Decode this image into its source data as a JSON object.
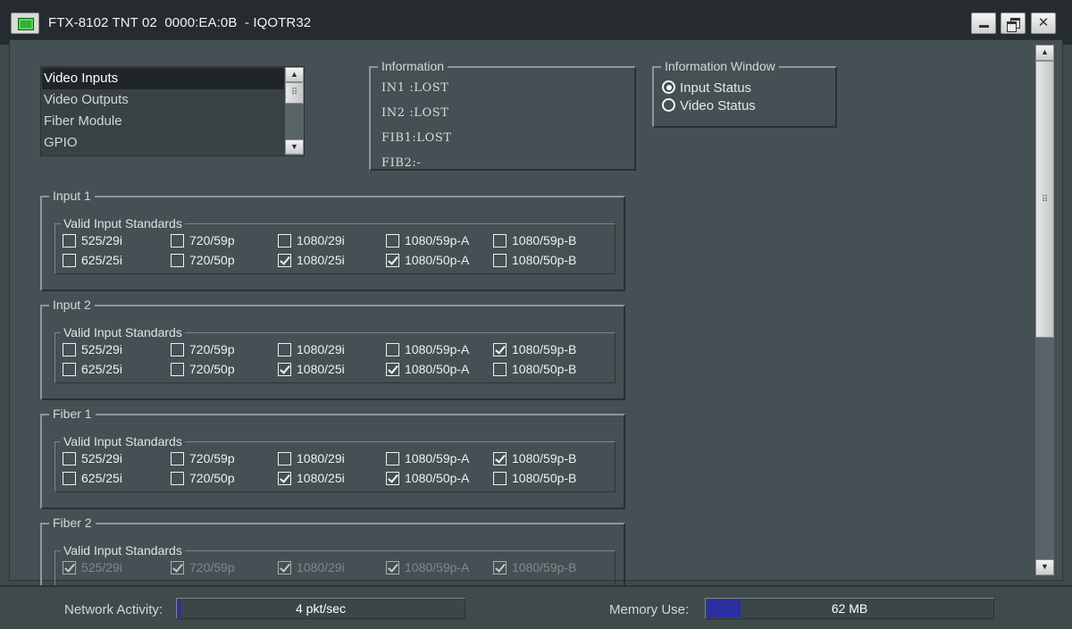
{
  "window": {
    "title": "FTX-8102 TNT 02  0000:EA:0B  - IQOTR32"
  },
  "nav_list": {
    "items": [
      "Video Inputs",
      "Video Outputs",
      "Fiber Module",
      "GPIO"
    ],
    "selected": "Video Inputs"
  },
  "information": {
    "title": "Information",
    "lines": [
      "IN1 :LOST",
      "IN2 :LOST",
      "FIB1:LOST",
      "FIB2:-"
    ]
  },
  "info_window": {
    "title": "Information Window",
    "options": [
      "Input Status",
      "Video Status"
    ],
    "selected": "Input Status"
  },
  "standards_labels": [
    "525/29i",
    "625/25i",
    "720/59p",
    "720/50p",
    "1080/29i",
    "1080/25i",
    "1080/59p-A",
    "1080/50p-A",
    "1080/59p-B",
    "1080/50p-B"
  ],
  "groups": [
    {
      "title": "Input 1",
      "subtitle": "Valid Input Standards",
      "checked": [
        false,
        false,
        false,
        false,
        false,
        true,
        false,
        true,
        false,
        false
      ],
      "enabled": true
    },
    {
      "title": "Input 2",
      "subtitle": "Valid Input Standards",
      "checked": [
        false,
        false,
        false,
        false,
        false,
        true,
        false,
        true,
        true,
        false
      ],
      "enabled": true
    },
    {
      "title": "Fiber 1",
      "subtitle": "Valid Input Standards",
      "checked": [
        false,
        false,
        false,
        false,
        false,
        true,
        false,
        true,
        true,
        false
      ],
      "enabled": true
    },
    {
      "title": "Fiber 2",
      "subtitle": "Valid Input Standards",
      "checked": [
        true,
        null,
        true,
        null,
        true,
        null,
        true,
        null,
        true,
        null
      ],
      "enabled": false
    }
  ],
  "status": {
    "network_label": "Network Activity:",
    "network_value": "4 pkt/sec",
    "network_level": 0.01,
    "memory_label": "Memory Use:",
    "memory_value": "62 MB",
    "memory_level": 0.12,
    "meter_color": "#2b2fa0"
  }
}
